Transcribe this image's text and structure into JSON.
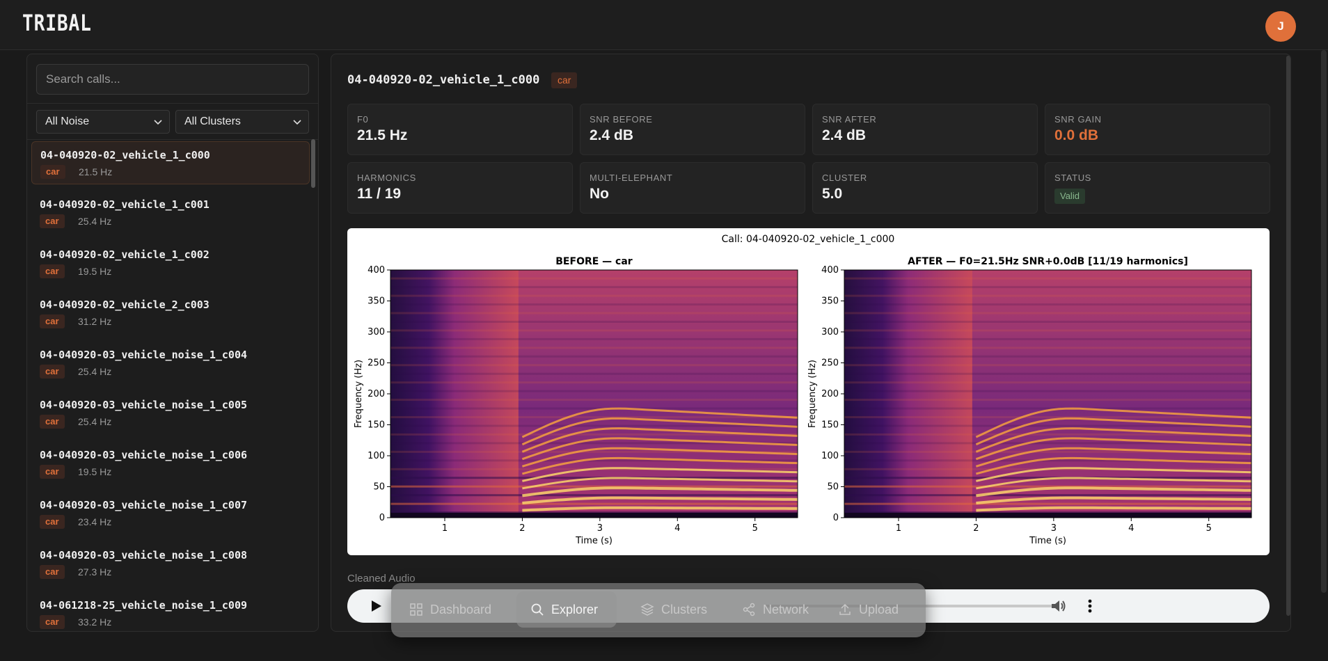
{
  "app": {
    "name": "TRIBAL",
    "user_initial": "J"
  },
  "sidebar": {
    "search_placeholder": "Search calls...",
    "noise_filter": "All Noise",
    "cluster_filter": "All Clusters",
    "calls": [
      {
        "name": "04-040920-02_vehicle_1_c000",
        "tag": "car",
        "f0": "21.5 Hz"
      },
      {
        "name": "04-040920-02_vehicle_1_c001",
        "tag": "car",
        "f0": "25.4 Hz"
      },
      {
        "name": "04-040920-02_vehicle_1_c002",
        "tag": "car",
        "f0": "19.5 Hz"
      },
      {
        "name": "04-040920-02_vehicle_2_c003",
        "tag": "car",
        "f0": "31.2 Hz"
      },
      {
        "name": "04-040920-03_vehicle_noise_1_c004",
        "tag": "car",
        "f0": "25.4 Hz"
      },
      {
        "name": "04-040920-03_vehicle_noise_1_c005",
        "tag": "car",
        "f0": "25.4 Hz"
      },
      {
        "name": "04-040920-03_vehicle_noise_1_c006",
        "tag": "car",
        "f0": "19.5 Hz"
      },
      {
        "name": "04-040920-03_vehicle_noise_1_c007",
        "tag": "car",
        "f0": "23.4 Hz"
      },
      {
        "name": "04-040920-03_vehicle_noise_1_c008",
        "tag": "car",
        "f0": "27.3 Hz"
      },
      {
        "name": "04-061218-25_vehicle_noise_1_c009",
        "tag": "car",
        "f0": "33.2 Hz"
      }
    ]
  },
  "detail": {
    "title": "04-040920-02_vehicle_1_c000",
    "tag": "car",
    "stats": [
      {
        "label": "F0",
        "value": "21.5 Hz"
      },
      {
        "label": "SNR BEFORE",
        "value": "2.4 dB"
      },
      {
        "label": "SNR AFTER",
        "value": "2.4 dB"
      },
      {
        "label": "SNR GAIN",
        "value": "0.0 dB"
      },
      {
        "label": "HARMONICS",
        "value": "11 / 19"
      },
      {
        "label": "MULTI-ELEPHANT",
        "value": "No"
      },
      {
        "label": "CLUSTER",
        "value": "5.0"
      },
      {
        "label": "STATUS",
        "value": "Valid"
      }
    ],
    "audio_label": "Cleaned Audio"
  },
  "chart_data": {
    "type": "heatmap",
    "title": "Call: 04-040920-02_vehicle_1_c000",
    "panels": [
      {
        "title": "BEFORE — car",
        "xlabel": "Time (s)",
        "ylabel": "Frequency (Hz)"
      },
      {
        "title": "AFTER — F0=21.5Hz SNR+0.0dB [11/19 harmonics]",
        "xlabel": "Time (s)",
        "ylabel": "Frequency (Hz)"
      }
    ],
    "xlim": [
      0.3,
      5.55
    ],
    "ylim": [
      0,
      400
    ],
    "xticks": [
      1,
      2,
      3,
      4,
      5
    ],
    "yticks": [
      0,
      50,
      100,
      150,
      200,
      250,
      300,
      350,
      400
    ],
    "colormap": "inferno"
  },
  "dock": {
    "items": [
      {
        "label": "Dashboard",
        "icon": "grid-icon"
      },
      {
        "label": "Explorer",
        "icon": "search-icon"
      },
      {
        "label": "Clusters",
        "icon": "layers-icon"
      },
      {
        "label": "Network",
        "icon": "share-icon"
      },
      {
        "label": "Upload",
        "icon": "upload-icon"
      }
    ]
  }
}
